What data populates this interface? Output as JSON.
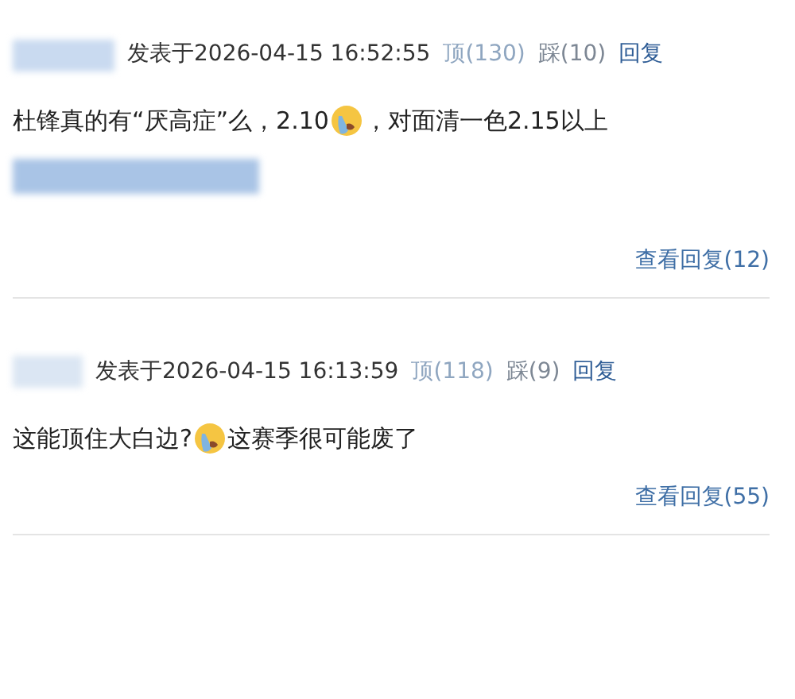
{
  "comments": [
    {
      "posted": "发表于2026-04-15 16:52:55",
      "up": "顶(130)",
      "down": "踩(10)",
      "reply": "回复",
      "content": [
        {
          "kind": "text",
          "text": "杜锋真的有“厌高症”么，2.10"
        },
        {
          "kind": "emoji"
        },
        {
          "kind": "text",
          "text": "，对面清一色2.15以上"
        }
      ],
      "blurred_line": true,
      "view_replies": "查看回复(12)"
    },
    {
      "posted": "发表于2026-04-15 16:13:59",
      "up": "顶(118)",
      "down": "踩(9)",
      "reply": "回复",
      "content": [
        {
          "kind": "text",
          "text": "这能顶住大白边?"
        },
        {
          "kind": "emoji"
        },
        {
          "kind": "text",
          "text": "这赛季很可能废了"
        }
      ],
      "blurred_line": false,
      "view_replies": "查看回复(55)"
    }
  ]
}
